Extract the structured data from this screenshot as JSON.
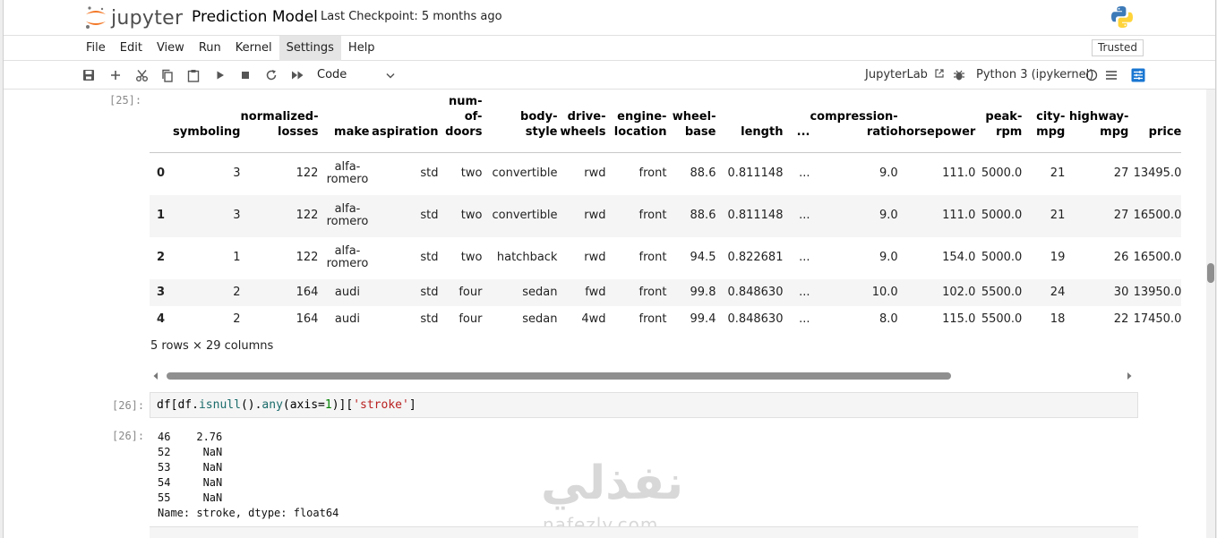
{
  "header": {
    "logo_text": "jupyter",
    "notebook_title": "Prediction Model",
    "checkpoint": "Last Checkpoint: 5 months ago"
  },
  "menu": [
    "File",
    "Edit",
    "View",
    "Run",
    "Kernel",
    "Settings",
    "Help"
  ],
  "trusted": "Trusted",
  "toolbar": {
    "cell_type": "Code",
    "jupyterlab": "JupyterLab",
    "kernel": "Python 3 (ipykernel)"
  },
  "cell25": {
    "prompt": "[25]:",
    "columns": [
      "symboling",
      "normalized-\nlosses",
      "make",
      "aspiration",
      "num-\nof-\ndoors",
      "body-\nstyle",
      "drive-\nwheels",
      "engine-\nlocation",
      "wheel-\nbase",
      "length",
      "...",
      "compression-\nratio",
      "horsepower",
      "peak-\nrpm",
      "city-\nmpg",
      "highway-\nmpg",
      "price"
    ],
    "rows": [
      [
        "0",
        "3",
        "122",
        "alfa-\nromero",
        "std",
        "two",
        "convertible",
        "rwd",
        "front",
        "88.6",
        "0.811148",
        "...",
        "9.0",
        "111.0",
        "5000.0",
        "21",
        "27",
        "13495.0"
      ],
      [
        "1",
        "3",
        "122",
        "alfa-\nromero",
        "std",
        "two",
        "convertible",
        "rwd",
        "front",
        "88.6",
        "0.811148",
        "...",
        "9.0",
        "111.0",
        "5000.0",
        "21",
        "27",
        "16500.0"
      ],
      [
        "2",
        "1",
        "122",
        "alfa-\nromero",
        "std",
        "two",
        "hatchback",
        "rwd",
        "front",
        "94.5",
        "0.822681",
        "...",
        "9.0",
        "154.0",
        "5000.0",
        "19",
        "26",
        "16500.0"
      ],
      [
        "3",
        "2",
        "164",
        "audi",
        "std",
        "four",
        "sedan",
        "fwd",
        "front",
        "99.8",
        "0.848630",
        "...",
        "10.0",
        "102.0",
        "5500.0",
        "24",
        "30",
        "13950.0"
      ],
      [
        "4",
        "2",
        "164",
        "audi",
        "std",
        "four",
        "sedan",
        "4wd",
        "front",
        "99.4",
        "0.848630",
        "...",
        "8.0",
        "115.0",
        "5500.0",
        "18",
        "22",
        "17450.0"
      ]
    ],
    "row_count": "5 rows × 29 columns"
  },
  "cell26": {
    "prompt_in": "[26]:",
    "code_parts": [
      "df[df.",
      "isnull",
      "().",
      "any",
      "(axis=",
      "1",
      ")][",
      "'stroke'",
      "]"
    ],
    "prompt_out": "[26]:",
    "output": "46    2.76\n52     NaN\n53     NaN\n54     NaN\n55     NaN\nName: stroke, dtype: float64"
  },
  "watermark": {
    "arabic": "نفذلي",
    "latin": "nafezly.com"
  }
}
